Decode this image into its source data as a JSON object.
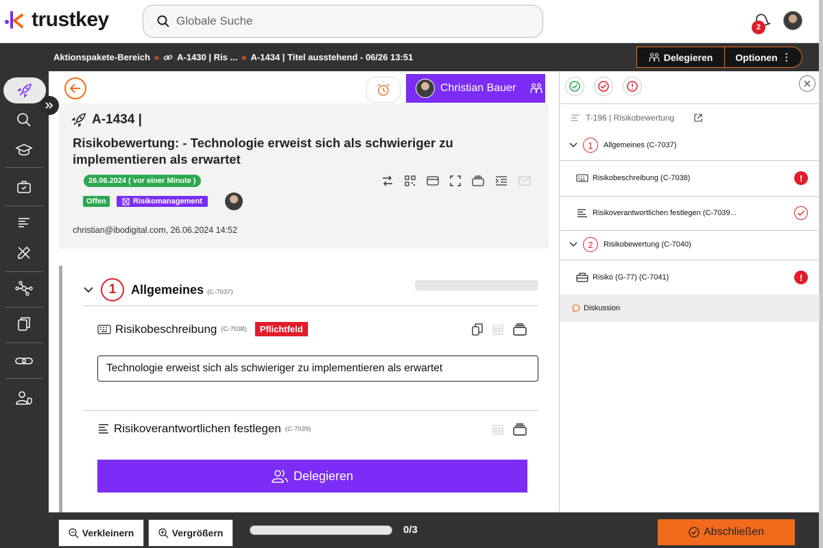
{
  "app": {
    "name": "trustkey",
    "brand_color": "#7b2cf5",
    "accent_color": "#f26b1d"
  },
  "search": {
    "placeholder": "Globale Suche"
  },
  "notifications": {
    "count": "2"
  },
  "breadcrumb": {
    "items": [
      "Aktionspakete-Bereich",
      "A-1430 | Ris ...",
      "A-1434 | Titel ausstehend - 06/26 13:51"
    ]
  },
  "actions": {
    "delegate": "Delegieren",
    "options": "Optionen"
  },
  "sidebar": {
    "items": [
      "rocket-icon",
      "search-icon",
      "graduation-cap-icon",
      "briefcase-icon",
      "list-icon",
      "edit-tools-icon",
      "network-icon",
      "copy-icon",
      "link-icon",
      "user-shield-icon"
    ]
  },
  "task": {
    "assignee": "Christian Bauer",
    "id": "A-1434 |",
    "title": "Risikobewertung: - Technologie erweist sich als schwieriger zu implementieren als erwartet",
    "date_pill": "26.06.2024 ( vor einer Minute )",
    "status": "Offen",
    "category": "Risikomanagement",
    "meta": "christian@ibodigital.com, 26.06.2024 14:52"
  },
  "form": {
    "section1": {
      "number": "1",
      "title": "Allgemeines",
      "code": "(C-7037)"
    },
    "field1": {
      "label": "Risikobeschreibung",
      "code": "(C-7038)",
      "required": "Pflichtfeld",
      "value": "Technologie erweist sich als schwieriger zu implementieren als erwartet"
    },
    "field2": {
      "label": "Risikoverantwortlichen festlegen",
      "code": "(C-7039)",
      "button": "Delegieren"
    }
  },
  "rpanel": {
    "template": "T-196 | Risikobewertung",
    "rows": [
      {
        "label": "Allgemeines (C-7037)",
        "number": "1"
      },
      {
        "label": "Risikobeschreibung (C-7038)",
        "status": "error"
      },
      {
        "label": "Risikoverantwortlichen festlegen (C-7039...",
        "status": "ok"
      },
      {
        "label": "Risikobewertung (C-7040)",
        "number": "2"
      },
      {
        "label": "Risiko (G-77) (C-7041)",
        "status": "error"
      }
    ],
    "discussion": "Diskussion",
    "error_mark": "!"
  },
  "bottom": {
    "zoom_out": "Verkleinern",
    "zoom_in": "Vergrößern",
    "progress_label": "0/3",
    "progress_fraction": 0,
    "finish": "Abschließen"
  }
}
